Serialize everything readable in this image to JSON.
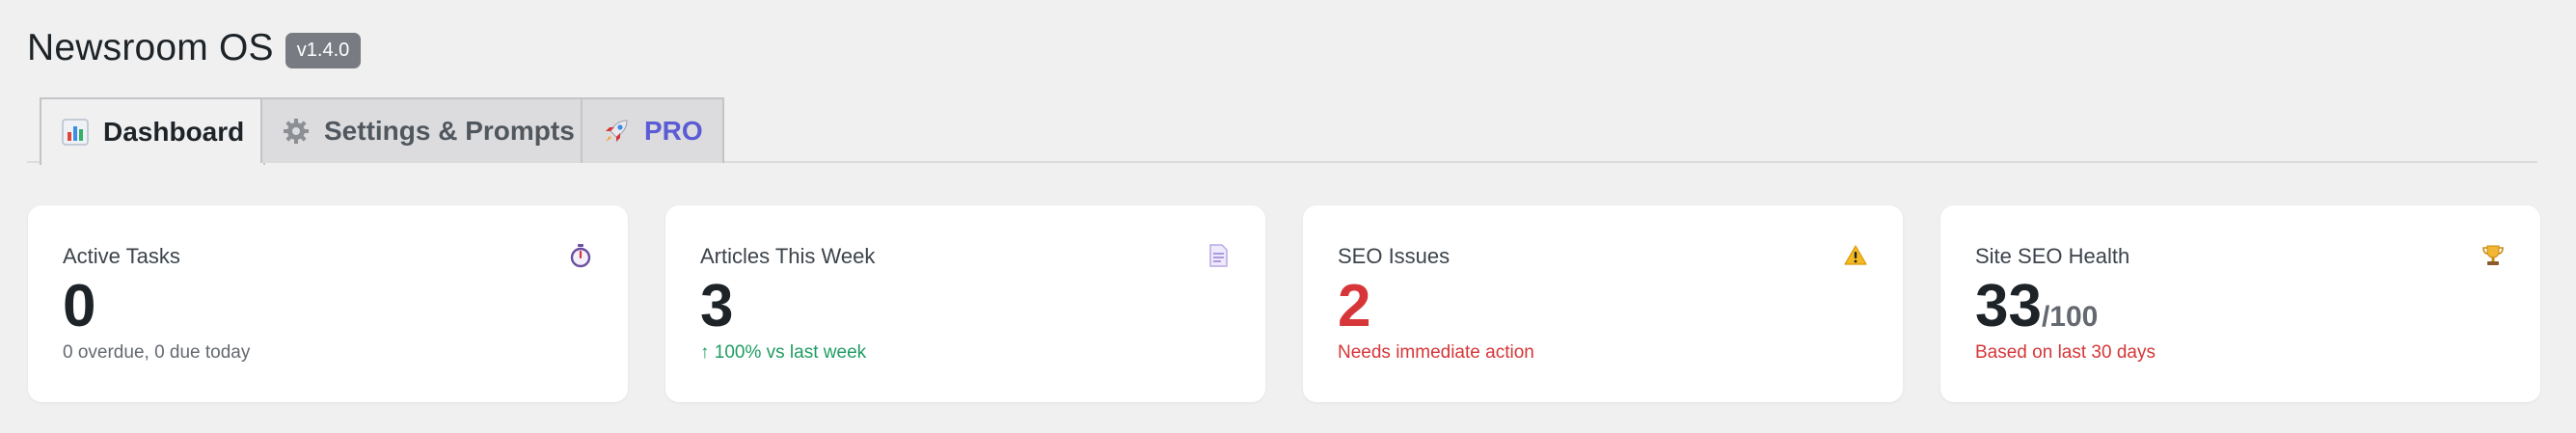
{
  "app": {
    "title": "Newsroom OS",
    "version": "v1.4.0"
  },
  "tabs": [
    {
      "label": "Dashboard",
      "icon": "bar-chart-icon",
      "active": true
    },
    {
      "label": "Settings & Prompts",
      "icon": "gear-icon",
      "active": false
    },
    {
      "label": "PRO",
      "icon": "rocket-icon",
      "active": false
    }
  ],
  "cards": [
    {
      "label": "Active Tasks",
      "icon": "stopwatch-icon",
      "value": "0",
      "suffix": "",
      "sub": "0 overdue, 0 due today",
      "sub_color": "#646970"
    },
    {
      "label": "Articles This Week",
      "icon": "document-icon",
      "value": "3",
      "suffix": "",
      "sub": "↑ 100% vs last week",
      "sub_color": "#1f9d63"
    },
    {
      "label": "SEO Issues",
      "icon": "warning-icon",
      "value": "2",
      "suffix": "",
      "sub": "Needs immediate action",
      "sub_color": "#d63638"
    },
    {
      "label": "Site SEO Health",
      "icon": "trophy-icon",
      "value": "33",
      "suffix": "/100",
      "sub": "Based on last 30 days",
      "sub_color": "#d63638"
    }
  ],
  "colors": {
    "background": "#f0f0f1",
    "accent_pro": "#5b5bd6",
    "danger": "#d63638",
    "success": "#1f9d63"
  }
}
